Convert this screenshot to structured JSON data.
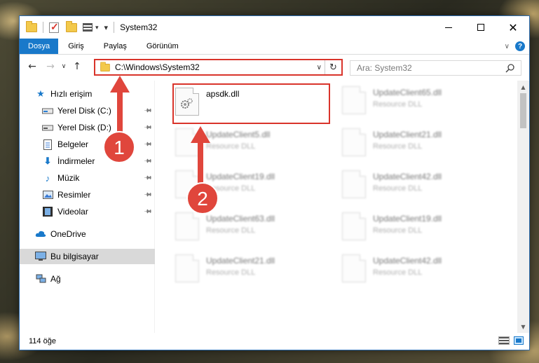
{
  "window": {
    "title": "System32"
  },
  "ribbon": {
    "tabs": [
      "Dosya",
      "Giriş",
      "Paylaş",
      "Görünüm"
    ]
  },
  "address": {
    "path": "C:\\Windows\\System32"
  },
  "search": {
    "placeholder": "Ara: System32"
  },
  "sidebar": {
    "items": [
      {
        "label": "Hızlı erişim",
        "icon": "star-icon"
      },
      {
        "label": "Yerel Disk (C:)",
        "icon": "drive-icon"
      },
      {
        "label": "Yerel Disk (D:)",
        "icon": "drive-icon"
      },
      {
        "label": "Belgeler",
        "icon": "documents-icon"
      },
      {
        "label": "İndirmeler",
        "icon": "download-icon"
      },
      {
        "label": "Müzik",
        "icon": "music-icon"
      },
      {
        "label": "Resimler",
        "icon": "pictures-icon"
      },
      {
        "label": "Videolar",
        "icon": "videos-icon"
      },
      {
        "label": "OneDrive",
        "icon": "cloud-icon"
      },
      {
        "label": "Bu bilgisayar",
        "icon": "computer-icon"
      },
      {
        "label": "Ağ",
        "icon": "network-icon"
      }
    ]
  },
  "files": {
    "main": {
      "name": "apsdk.dll"
    },
    "col1": [
      {
        "name": "UpdateClient5.dll",
        "type": "Resource DLL"
      },
      {
        "name": "UpdateClient19.dll",
        "type": "Resource DLL"
      },
      {
        "name": "UpdateClient63.dll",
        "type": "Resource DLL"
      },
      {
        "name": "UpdateClient21.dll",
        "type": "Resource DLL"
      }
    ],
    "col2": [
      {
        "name": "UpdateClient65.dll",
        "type": "Resource DLL"
      },
      {
        "name": "UpdateClient21.dll",
        "type": "Resource DLL"
      },
      {
        "name": "UpdateClient42.dll",
        "type": "Resource DLL"
      },
      {
        "name": "UpdateClient19.dll",
        "type": "Resource DLL"
      },
      {
        "name": "UpdateClient42.dll",
        "type": "Resource DLL"
      }
    ]
  },
  "status": {
    "count": "114 öğe"
  },
  "annotations": {
    "step1": "1",
    "step2": "2"
  },
  "colors": {
    "accent": "#1979ca",
    "highlight": "#d9342b",
    "selected": "#cce8ff"
  }
}
